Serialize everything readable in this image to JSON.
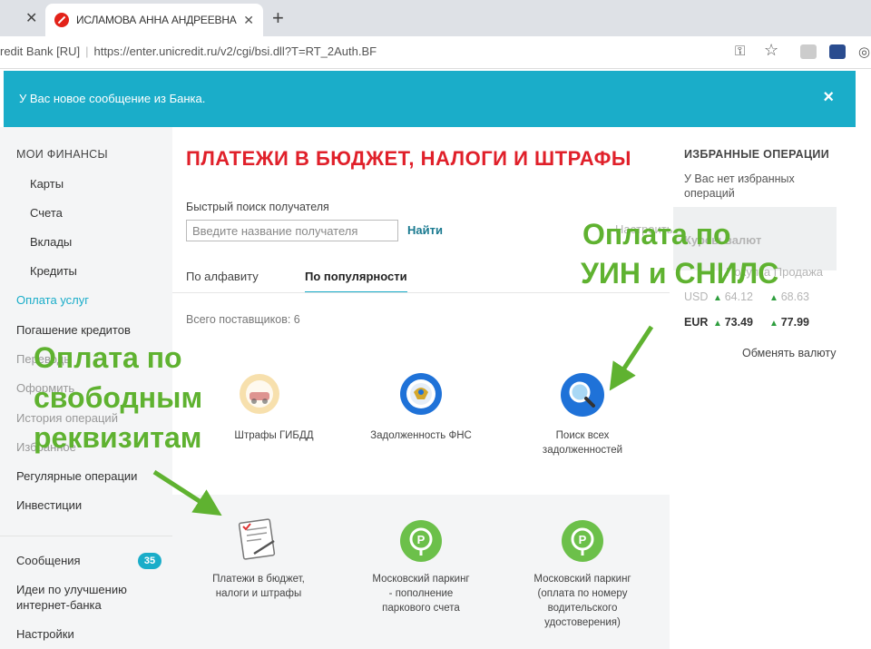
{
  "browser": {
    "tab_title": "ИСЛАМОВА АННА АНДРЕЕВНА",
    "site_name": "redit Bank [RU]",
    "url": "https://enter.unicredit.ru/v2/cgi/bsi.dll?T=RT_2Auth.BF"
  },
  "notice": {
    "text": "У Вас новое сообщение из Банка.",
    "close": "×"
  },
  "sidebar": {
    "section_title": "МОИ ФИНАНСЫ",
    "sub_items": [
      "Карты",
      "Счета",
      "Вклады",
      "Кредиты"
    ],
    "items": [
      "Оплата услуг",
      "Погашение кредитов",
      "Переводы",
      "Оформить",
      "История операций",
      "Избранное",
      "Регулярные операции",
      "Инвестиции"
    ],
    "messages_label": "Сообщения",
    "messages_count": "35",
    "ideas_line1": "Идеи по улучшению",
    "ideas_line2": "интернет-банка",
    "settings": "Настройки"
  },
  "main": {
    "title": "ПЛАТЕЖИ В БЮДЖЕТ, НАЛОГИ И ШТРАФЫ",
    "search_label": "Быстрый поиск получателя",
    "search_placeholder": "Введите название получателя",
    "search_button": "Найти",
    "tab_alphabet": "По алфавиту",
    "tab_popular": "По популярности",
    "provider_count": "Всего поставщиков: 6",
    "cards": [
      {
        "label_line1": "Штрафы ГИБДД",
        "label_line2": ""
      },
      {
        "label_line1": "Задолженность ФНС",
        "label_line2": ""
      },
      {
        "label_line1": "Поиск всех",
        "label_line2": "задолженностей"
      },
      {
        "label_line1": "Платежи в бюджет,",
        "label_line2": "налоги и штрафы"
      },
      {
        "label_line1": "Московский паркинг",
        "label_line2": "- пополнение",
        "label_line3": "паркового счета"
      },
      {
        "label_line1": "Московский паркинг",
        "label_line2": "(оплата по номеру",
        "label_line3": "водительского",
        "label_line4": "удостоверения)"
      }
    ]
  },
  "right_panel": {
    "title": "ИЗБРАННЫЕ ОПЕРАЦИИ",
    "empty_line1": "У Вас нет избранных",
    "empty_line2": "операций",
    "faded_header": "Настроить",
    "faded_rates": "Курсы валют",
    "faded_bank": "Покупка Продажа",
    "usd_label": "USD",
    "usd_buy": "64.12",
    "usd_sell": "68.63",
    "eur_label": "EUR",
    "eur_buy": "73.49",
    "eur_sell": "77.99",
    "exchange_link": "Обменять валюту"
  },
  "overlay": {
    "uin_line1": "Оплата по",
    "uin_line2": "УИН и СНИЛС",
    "free_line1": "Оплата по",
    "free_line2": "свободным",
    "free_line3": "реквизитам"
  },
  "colors": {
    "accent": "#1aadc9",
    "title_red": "#e0202a",
    "overlay_green": "#5fb230",
    "parking_green": "#6cc04a",
    "search_blue": "#1f72d8"
  }
}
